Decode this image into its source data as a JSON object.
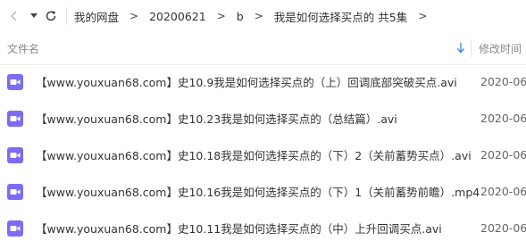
{
  "breadcrumb": {
    "items": [
      "我的网盘",
      "20200621",
      "b",
      "我是如何选择买点的 共5集"
    ]
  },
  "columns": {
    "name": "文件名",
    "modified": "修改时间"
  },
  "files": [
    {
      "name": "【www.youxuan68.com】史10.9我是如何选择买点的（上）回调底部突破买点.avi",
      "date": "2020-06-",
      "icon": "video-file-icon"
    },
    {
      "name": "【www.youxuan68.com】史10.23我是如何选择买点的（总结篇）.avi",
      "date": "2020-06-",
      "icon": "video-file-icon"
    },
    {
      "name": "【www.youxuan68.com】史10.18我是如何选择买点的（下）2（关前蓄势买点）.avi",
      "date": "2020-06-",
      "icon": "video-file-icon"
    },
    {
      "name": "【www.youxuan68.com】史10.16我是如何选择买点的（下）1（关前蓄势前瞻）.mp4",
      "date": "2020-06-",
      "icon": "video-file-icon"
    },
    {
      "name": "【www.youxuan68.com】史10.11我是如何选择买点的（中）上升回调买点.avi",
      "date": "2020-06-",
      "icon": "video-file-icon"
    }
  ],
  "colors": {
    "video_icon": "#7b6cf6",
    "sort_icon": "#3a8ee6"
  }
}
